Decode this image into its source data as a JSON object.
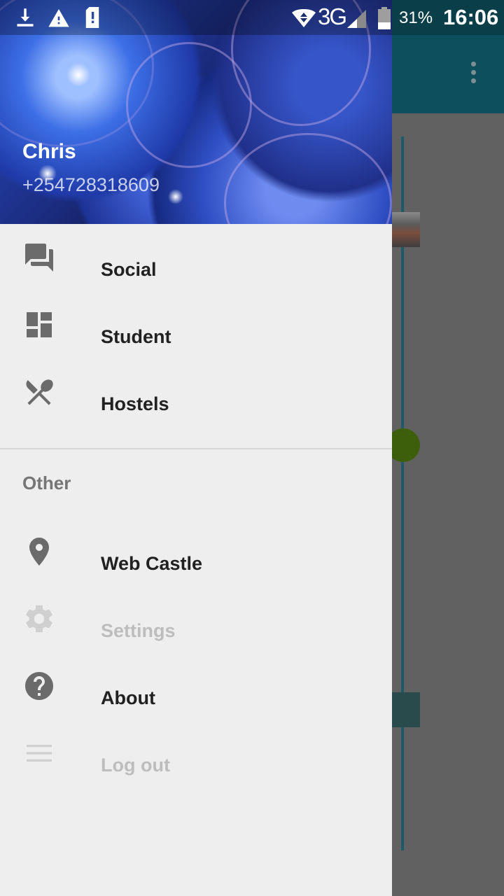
{
  "status_bar": {
    "network": "3G",
    "battery_percent": "31%",
    "time": "16:06",
    "icons": [
      "download-icon",
      "warning-icon",
      "sim-alert-icon",
      "wifi-icon",
      "signal-icon",
      "battery-icon"
    ]
  },
  "drawer": {
    "header": {
      "user_name": "Chris",
      "user_phone": "+254728318609"
    },
    "primary_items": [
      {
        "label": "Social",
        "icon": "forum-icon",
        "enabled": true
      },
      {
        "label": "Student",
        "icon": "dashboard-icon",
        "enabled": true
      },
      {
        "label": "Hostels",
        "icon": "restaurant-icon",
        "enabled": true
      }
    ],
    "section_header": "Other",
    "secondary_items": [
      {
        "label": "Web Castle",
        "icon": "location-pin-icon",
        "enabled": true
      },
      {
        "label": "Settings",
        "icon": "gear-icon",
        "enabled": false
      },
      {
        "label": "About",
        "icon": "help-icon",
        "enabled": true
      },
      {
        "label": "Log out",
        "icon": "menu-lines-icon",
        "enabled": false
      }
    ]
  },
  "colors": {
    "toolbar": "#0d4f5c",
    "drawer_bg": "#eeeeee",
    "icon_gray": "#6b6b6b",
    "disabled_gray": "#bdbdbd",
    "scrim": "#616161"
  }
}
